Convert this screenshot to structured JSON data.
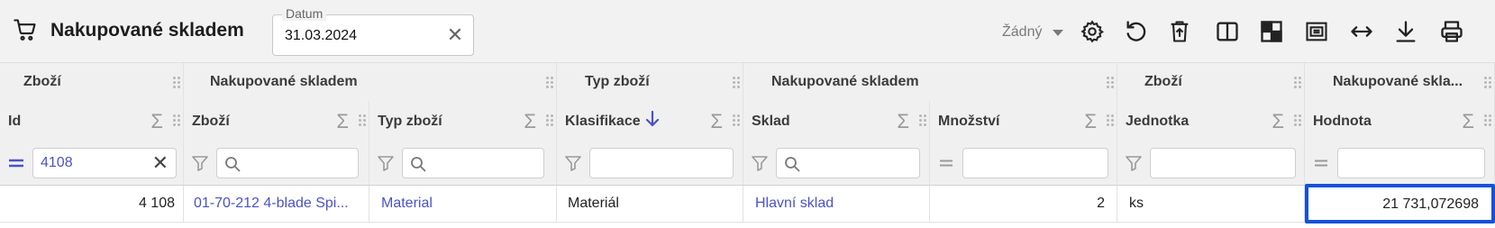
{
  "toolbar": {
    "title": "Nakupované skladem",
    "date": {
      "label": "Datum",
      "value": "31.03.2024"
    },
    "grouping_value": "Žádný",
    "icons": [
      "gear-icon",
      "reset-icon",
      "delete-icon",
      "columns-icon",
      "pivot-icon",
      "fit-icon",
      "width-icon",
      "download-icon",
      "print-icon"
    ]
  },
  "grid": {
    "groups": [
      "Zboží",
      "Nakupované skladem",
      "Typ zboží",
      "Nakupované skladem",
      "Zboží",
      "Nakupované skla..."
    ],
    "columns": [
      "Id",
      "Zboží",
      "Typ zboží",
      "Klasifikace",
      "Sklad",
      "Množství",
      "Jednotka",
      "Hodnota"
    ],
    "filter_id_value": "4108",
    "sort_column": "Klasifikace",
    "sort_direction": "desc",
    "row": {
      "id": "4 108",
      "item": "01-70-212 4-blade Spi...",
      "type": "Material",
      "classification": "Materiál",
      "warehouse": "Hlavní sklad",
      "quantity": "2",
      "unit": "ks",
      "value": "21 731,072698"
    }
  },
  "colors": {
    "accent": "#4a52c8",
    "selection": "#1652d8"
  }
}
